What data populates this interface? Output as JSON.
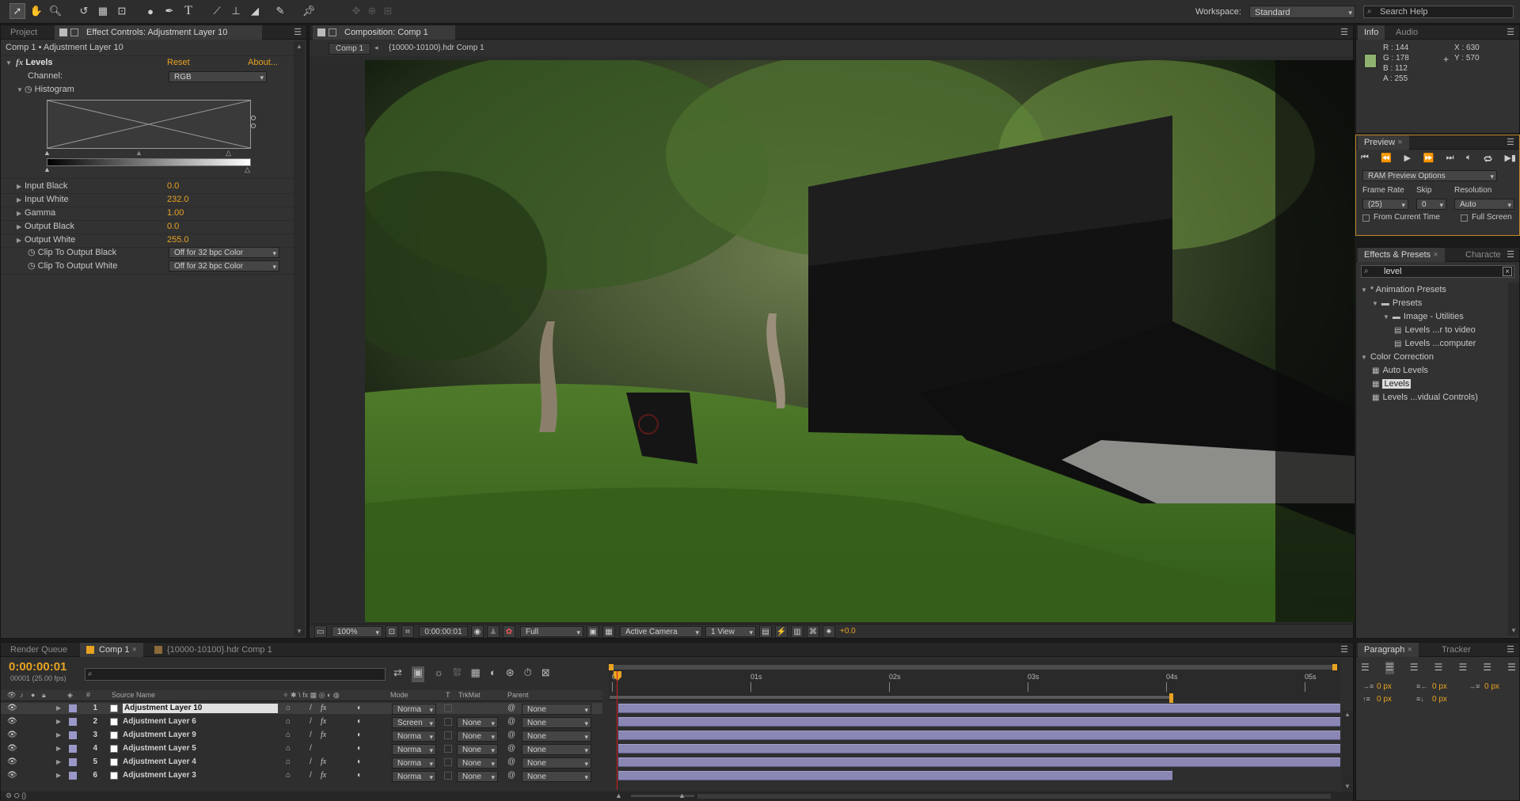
{
  "toolbar": {
    "tools": [
      "selection-tool",
      "hand-tool",
      "zoom-tool",
      "rotation-tool",
      "camera-tool",
      "pan-behind-tool",
      "ellipse-tool",
      "pen-tool",
      "type-tool",
      "brush-tool",
      "clone-stamp-tool",
      "eraser-tool",
      "roto-brush-tool",
      "puppet-pin-tool"
    ],
    "workspace_label": "Workspace:",
    "workspace_value": "Standard",
    "search_placeholder": "Search Help"
  },
  "effect_panel": {
    "tab_project": "Project",
    "tab_effect": "Effect Controls: Adjustment Layer 10",
    "breadcrumb": "Comp 1 • Adjustment Layer 10",
    "effect_name": "Levels",
    "reset": "Reset",
    "about": "About...",
    "channel_label": "Channel:",
    "channel_value": "RGB",
    "histogram_label": "Histogram",
    "params": [
      {
        "label": "Input Black",
        "value": "0.0"
      },
      {
        "label": "Input White",
        "value": "232.0"
      },
      {
        "label": "Gamma",
        "value": "1.00"
      },
      {
        "label": "Output Black",
        "value": "0.0"
      },
      {
        "label": "Output White",
        "value": "255.0"
      }
    ],
    "clip_black_label": "Clip To Output Black",
    "clip_black_value": "Off for 32 bpc Color",
    "clip_white_label": "Clip To Output White",
    "clip_white_value": "Off for 32 bpc Color"
  },
  "comp_panel": {
    "tab": "Composition: Comp 1",
    "nav_comp": "Comp 1",
    "nav_hdr": "{10000-10100}.hdr Comp 1",
    "zoom": "100%",
    "timecode": "0:00:00:01",
    "resolution": "Full",
    "camera": "Active Camera",
    "views": "1 View",
    "exposure": "+0.0"
  },
  "info_panel": {
    "tab_info": "Info",
    "tab_audio": "Audio",
    "r": "R : 144",
    "g": "G : 178",
    "b": "B : 112",
    "a": "A : 255",
    "x": "X : 630",
    "y": "Y : 570",
    "swatch_color": "#90b270"
  },
  "preview_panel": {
    "tab": "Preview",
    "ram_options": "RAM Preview Options",
    "frame_rate_label": "Frame Rate",
    "skip_label": "Skip",
    "resolution_label": "Resolution",
    "frame_rate_value": "(25)",
    "skip_value": "0",
    "resolution_value": "Auto",
    "from_current": "From Current Time",
    "full_screen": "Full Screen"
  },
  "effects_presets": {
    "tab_effects": "Effects & Presets",
    "tab_character": "Characte",
    "search_value": "level",
    "tree": [
      {
        "label": "* Animation Presets",
        "level": 0,
        "kind": "folder-open"
      },
      {
        "label": "Presets",
        "level": 1,
        "kind": "folder"
      },
      {
        "label": "Image - Utilities",
        "level": 2,
        "kind": "folder"
      },
      {
        "label": "Levels ...r to video",
        "level": 3,
        "kind": "preset"
      },
      {
        "label": "Levels ...computer",
        "level": 3,
        "kind": "preset"
      },
      {
        "label": "Color Correction",
        "level": 0,
        "kind": "folder-open"
      },
      {
        "label": "Auto Levels",
        "level": 1,
        "kind": "effect"
      },
      {
        "label": "Levels",
        "level": 1,
        "kind": "effect",
        "selected": true
      },
      {
        "label": "Levels ...vidual Controls)",
        "level": 1,
        "kind": "effect"
      }
    ]
  },
  "timeline": {
    "tab_render": "Render Queue",
    "tab_comp": "Comp 1",
    "tab_hdr": "{10000-10100}.hdr Comp 1",
    "timecode": "0:00:00:01",
    "frame_info": "00001 (25.00 fps)",
    "header_source": "Source Name",
    "header_mode": "Mode",
    "header_t": "T",
    "header_trkmat": "TrkMat",
    "header_parent": "Parent",
    "ruler": [
      "0s",
      "01s",
      "02s",
      "03s",
      "04s",
      "05s"
    ],
    "layers": [
      {
        "num": "1",
        "name": "Adjustment Layer 10",
        "mode": "Norma",
        "trkmat": "",
        "parent": "None",
        "fx": true,
        "selected": true
      },
      {
        "num": "2",
        "name": "Adjustment Layer 6",
        "mode": "Screen",
        "trkmat": "None",
        "parent": "None",
        "fx": true
      },
      {
        "num": "3",
        "name": "Adjustment Layer 9",
        "mode": "Norma",
        "trkmat": "None",
        "parent": "None",
        "fx": true
      },
      {
        "num": "4",
        "name": "Adjustment Layer 5",
        "mode": "Norma",
        "trkmat": "None",
        "parent": "None",
        "fx": false
      },
      {
        "num": "5",
        "name": "Adjustment Layer 4",
        "mode": "Norma",
        "trkmat": "None",
        "parent": "None",
        "fx": true
      },
      {
        "num": "6",
        "name": "Adjustment Layer 3",
        "mode": "Norma",
        "trkmat": "None",
        "parent": "None",
        "fx": true
      }
    ]
  },
  "paragraph_panel": {
    "tab_paragraph": "Paragraph",
    "tab_tracker": "Tracker",
    "indent_values": [
      "0 px",
      "0 px",
      "0 px",
      "0 px",
      "0 px"
    ]
  }
}
